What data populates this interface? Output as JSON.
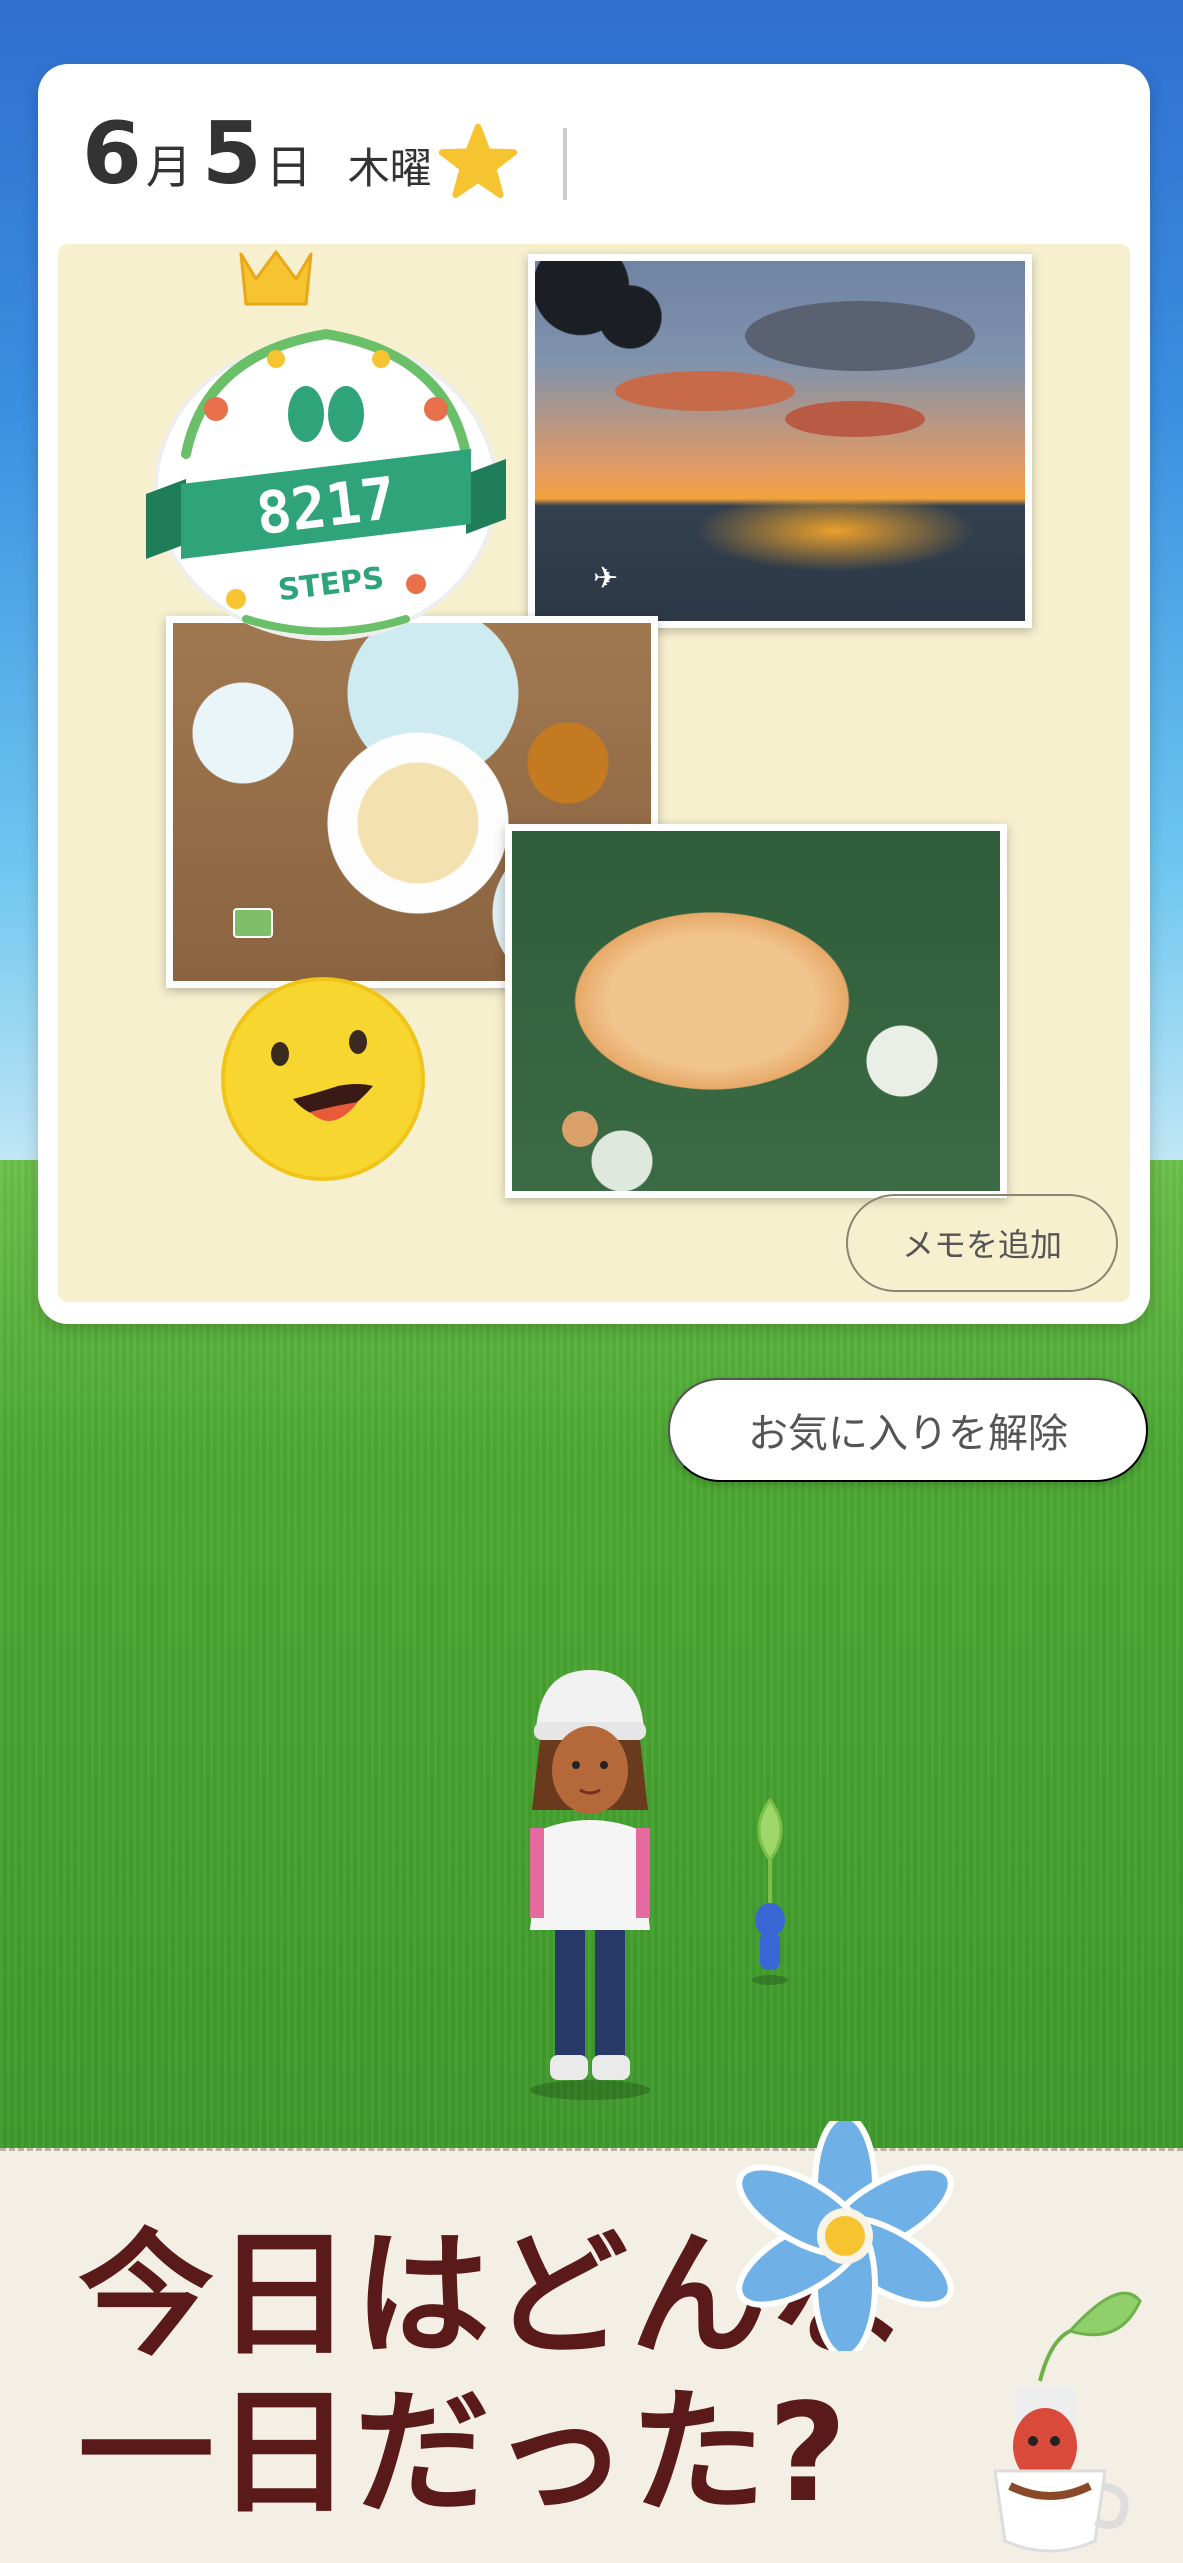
{
  "card": {
    "month_num": "6",
    "month_kanji": "月",
    "day_num": "5",
    "day_kanji": "日",
    "weekday": "木曜",
    "favorite": true
  },
  "badge": {
    "steps_value": "8217",
    "steps_label": "STEPS"
  },
  "buttons": {
    "add_memo": "メモを追加",
    "remove_favorite": "お気に入りを解除"
  },
  "banner": {
    "line1": "今日はどんな",
    "line2": "一日だった?"
  },
  "colors": {
    "star": "#f6c431",
    "headline": "#5a1a1a",
    "collage_bg": "#f7f0cf",
    "badge_green": "#2fa37a"
  }
}
